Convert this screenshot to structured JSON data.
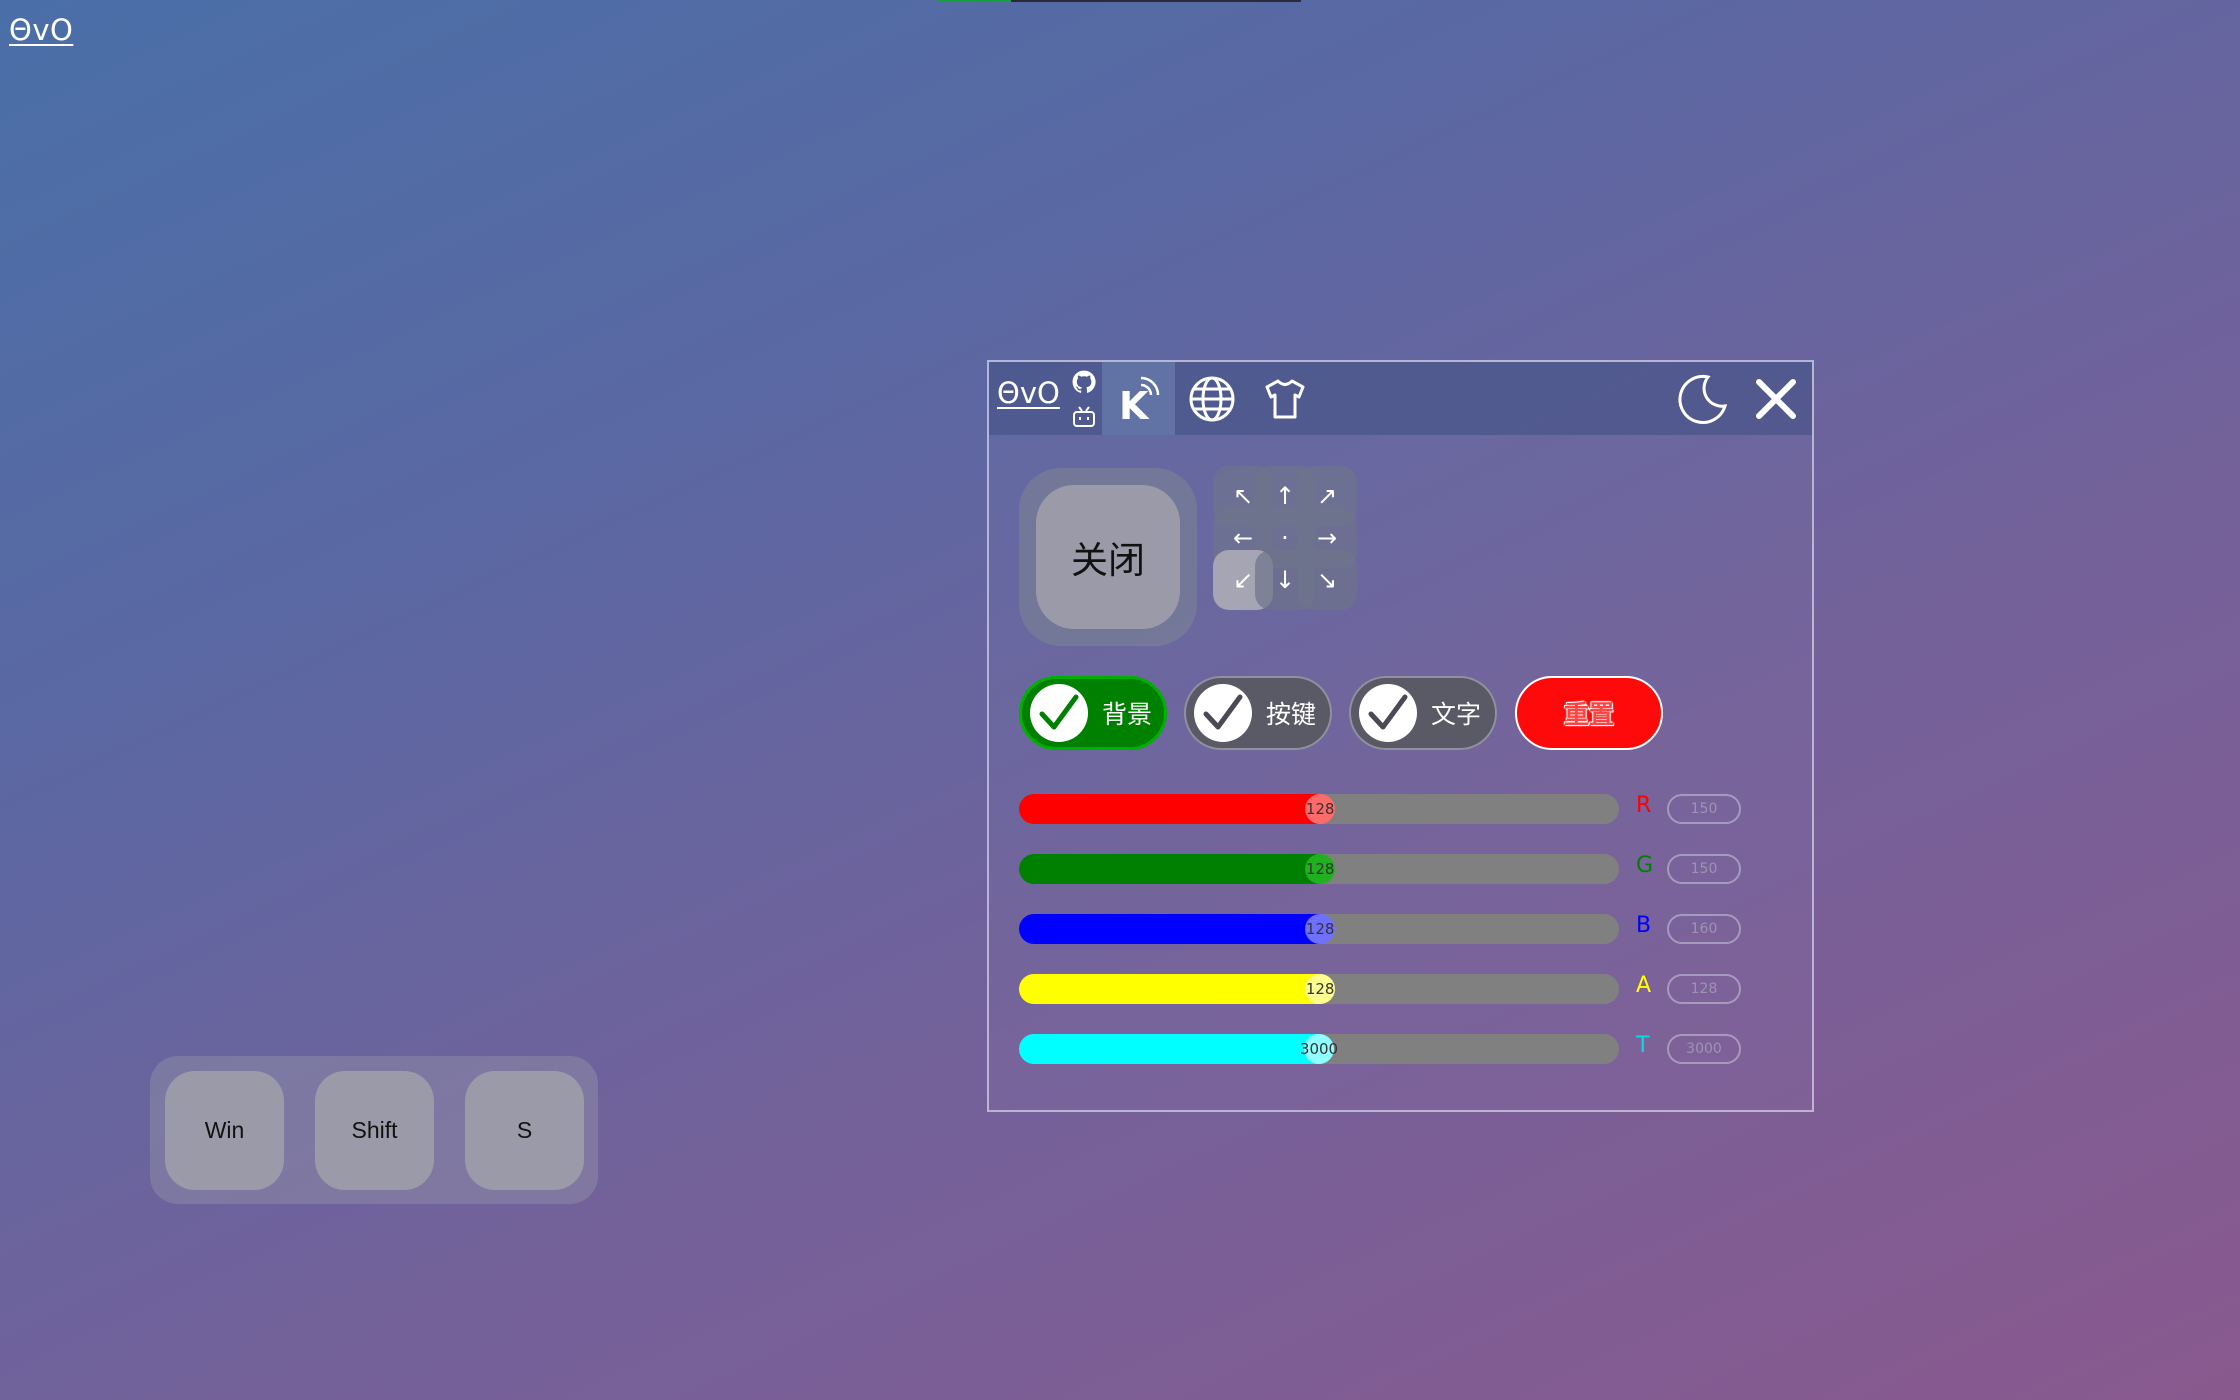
{
  "corner_logo": "ΘvO",
  "top_progress": {
    "fraction": 0.2
  },
  "keys": [
    "Win",
    "Shift",
    "S"
  ],
  "panel": {
    "logo": "ΘvO",
    "tabs": [
      {
        "icon": "keyboard-signal-icon",
        "label": "K",
        "active": true
      },
      {
        "icon": "globe-icon",
        "active": false
      },
      {
        "icon": "shirt-icon",
        "active": false
      }
    ],
    "moon_icon": "moon-icon",
    "close_icon": "close-icon",
    "main_button": "关闭",
    "direction_pad": [
      {
        "glyph": "↖",
        "active": false
      },
      {
        "glyph": "↑",
        "active": false
      },
      {
        "glyph": "↗",
        "active": false
      },
      {
        "glyph": "←",
        "active": false
      },
      {
        "glyph": "·",
        "active": false
      },
      {
        "glyph": "→",
        "active": false
      },
      {
        "glyph": "↙",
        "active": true
      },
      {
        "glyph": "↓",
        "active": false
      },
      {
        "glyph": "↘",
        "active": false
      }
    ],
    "toggles": [
      {
        "label": "背景",
        "bg": "#008000",
        "checked": true,
        "check_color": "#008000"
      },
      {
        "label": "按键",
        "bg": "#5a5a66",
        "checked": true,
        "check_color": "#4a4a55"
      },
      {
        "label": "文字",
        "bg": "#5a5a66",
        "checked": true,
        "check_color": "#4a4a55"
      }
    ],
    "reset_label": "重置",
    "sliders": [
      {
        "label": "R",
        "value": 128,
        "max": 255,
        "color": "#ff0000",
        "knob": "#ff6a6a",
        "label_color": "#ff0000",
        "box": "150"
      },
      {
        "label": "G",
        "value": 128,
        "max": 255,
        "color": "#008000",
        "knob": "#20b020",
        "label_color": "#008000",
        "box": "150"
      },
      {
        "label": "B",
        "value": 128,
        "max": 255,
        "color": "#0000ff",
        "knob": "#7070ff",
        "label_color": "#0000ff",
        "box": "160"
      },
      {
        "label": "A",
        "value": 128,
        "max": 255,
        "color": "#ffff00",
        "knob": "#ffff90",
        "label_color": "#ffff00",
        "box": "128"
      },
      {
        "label": "T",
        "value": 3000,
        "max": 6000,
        "color": "#00ffff",
        "knob": "#90ffff",
        "label_color": "#00e0e0",
        "box": "3000"
      }
    ]
  },
  "colors": {
    "bg_start": "#4a6fa8",
    "bg_end": "#89598e",
    "reset": "#ff0a0a"
  }
}
